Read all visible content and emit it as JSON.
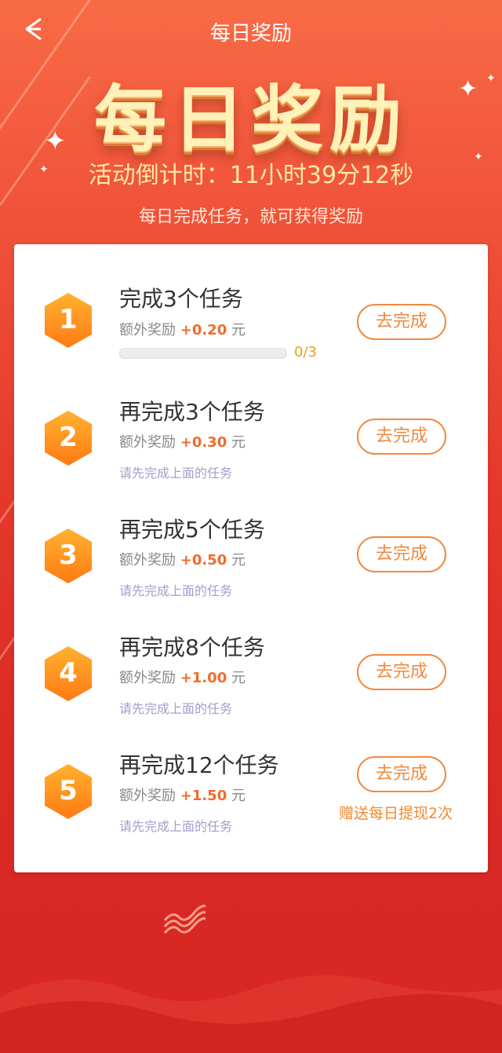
{
  "header": {
    "title": "每日奖励",
    "back_icon": "back-arrow-icon"
  },
  "hero": {
    "title": "每日奖励"
  },
  "countdown": {
    "text": "活动倒计时：11小时39分12秒"
  },
  "subtitle": {
    "text": "每日完成任务，就可获得奖励"
  },
  "colors": {
    "accent": "#f1893e",
    "amount": "#f26b2b",
    "note": "#a99acb",
    "background_top": "#f86b45",
    "background_bottom": "#d72624"
  },
  "tasks": [
    {
      "num": "1",
      "title": "完成3个任务",
      "reward_prefix": "额外奖励",
      "reward_amount": "+0.20",
      "reward_unit": "元",
      "button": "去完成",
      "progress_text": "0/3",
      "progress_done": 0,
      "progress_total": 3
    },
    {
      "num": "2",
      "title": "再完成3个任务",
      "reward_prefix": "额外奖励",
      "reward_amount": "+0.30",
      "reward_unit": "元",
      "button": "去完成",
      "note": "请先完成上面的任务"
    },
    {
      "num": "3",
      "title": "再完成5个任务",
      "reward_prefix": "额外奖励",
      "reward_amount": "+0.50",
      "reward_unit": "元",
      "button": "去完成",
      "note": "请先完成上面的任务"
    },
    {
      "num": "4",
      "title": "再完成8个任务",
      "reward_prefix": "额外奖励",
      "reward_amount": "+1.00",
      "reward_unit": "元",
      "button": "去完成",
      "note": "请先完成上面的任务"
    },
    {
      "num": "5",
      "title": "再完成12个任务",
      "reward_prefix": "额外奖励",
      "reward_amount": "+1.50",
      "reward_unit": "元",
      "button": "去完成",
      "note": "请先完成上面的任务",
      "extra": "赠送每日提现2次"
    }
  ]
}
